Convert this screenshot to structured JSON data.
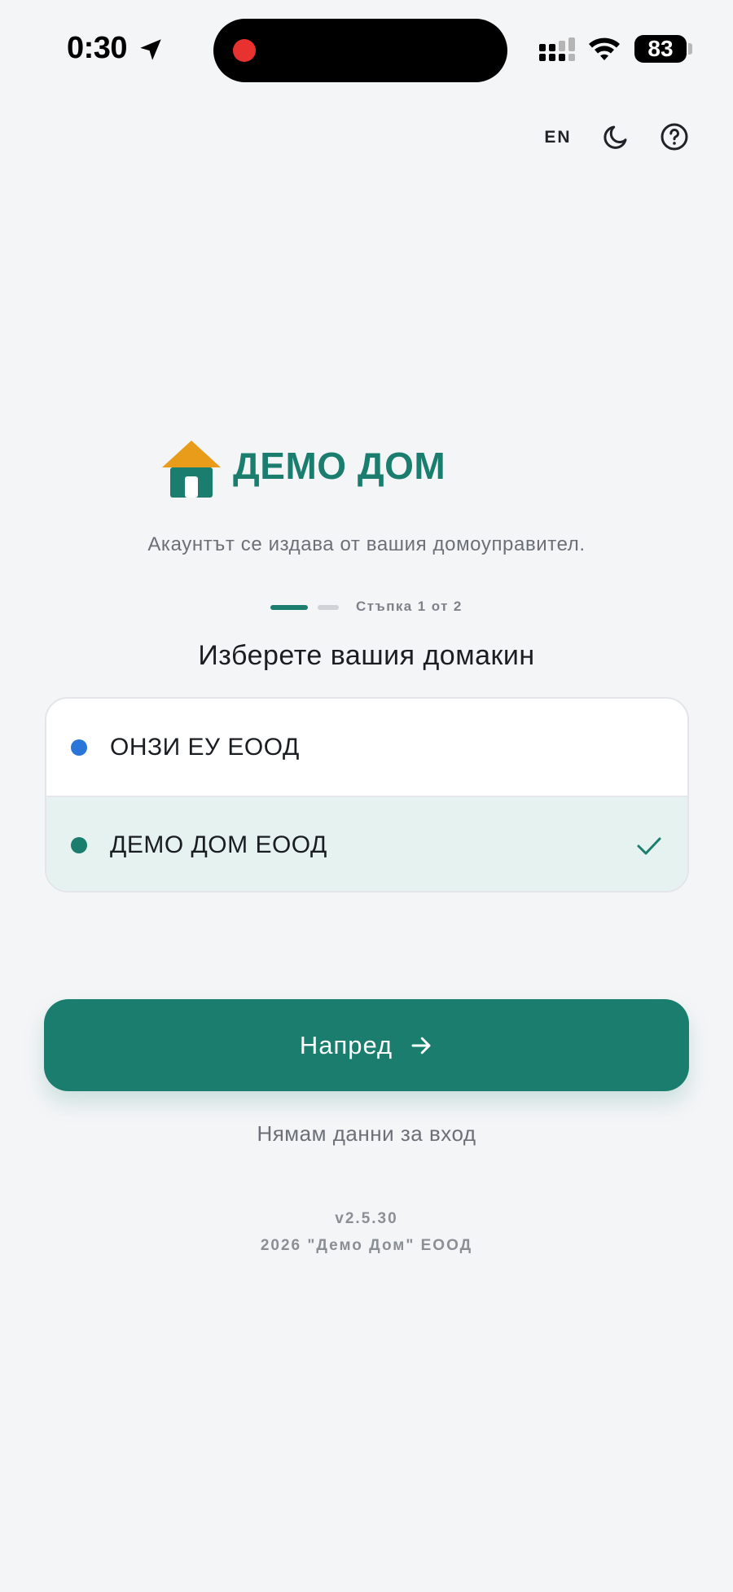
{
  "status_bar": {
    "time": "0:30",
    "battery": "83"
  },
  "top_actions": {
    "language": "EN",
    "theme_icon": "moon-icon",
    "help_icon": "help-circle-icon"
  },
  "brand": {
    "logo_icon": "house-icon",
    "name": "ДЕМО ДОМ"
  },
  "subtitle": "Акаунтът се издава от вашия домоуправител.",
  "stepper": {
    "label": "Стъпка 1 от 2",
    "current": 1,
    "total": 2
  },
  "section_title": "Изберете вашия домакин",
  "hosts": [
    {
      "name": "ОНЗИ ЕУ ЕООД",
      "dot_color": "#2a75d8",
      "selected": false
    },
    {
      "name": "ДЕМО ДОМ ЕООД",
      "dot_color": "#1b7d6e",
      "selected": true
    }
  ],
  "next_button": {
    "label": "Напред",
    "icon": "arrow-right-icon"
  },
  "no_login_link": "Нямам данни за вход",
  "footer": {
    "version": "v2.5.30",
    "copyright": "2026 \"Демо Дом\" ЕООД"
  },
  "colors": {
    "accent": "#1b7d6e",
    "roof": "#e89c1a",
    "background": "#f4f5f7"
  }
}
